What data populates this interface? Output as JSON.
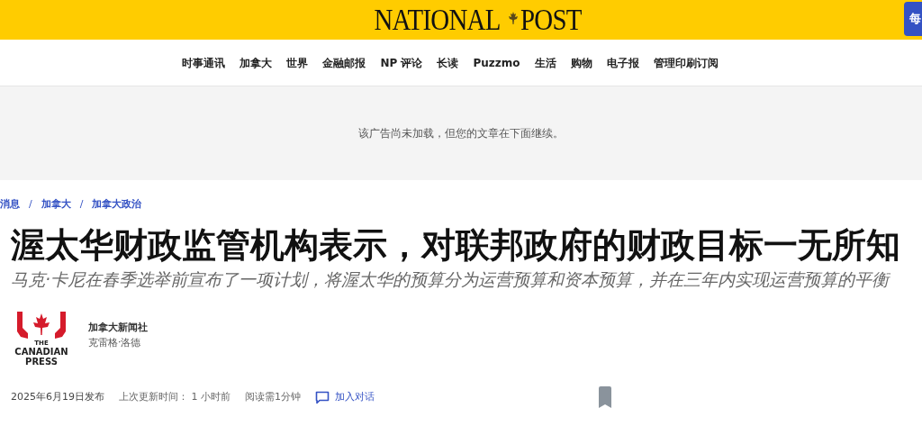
{
  "masthead": {
    "logo_left": "NATIONAL",
    "logo_right": "POST",
    "button": "每"
  },
  "nav": [
    "时事通讯",
    "加拿大",
    "世界",
    "金融邮报",
    "NP 评论",
    "长读",
    "Puzzmo",
    "生活",
    "购物",
    "电子报",
    "管理印刷订阅"
  ],
  "ad_notice": "该广告尚未加载，但您的文章在下面继续。",
  "breadcrumb": [
    "消息",
    "加拿大",
    "加拿大政治"
  ],
  "breadcrumb_separator": "/",
  "headline": "渥太华财政监管机构表示，对联邦政府的财政目标一无所知",
  "subheadline": "马克·卡尼在春季选举前宣布了一项计划，将渥太华的预算分为运营预算和资本预算，并在三年内实现运营预算的平衡",
  "source_logo": {
    "small": "THE",
    "line1": "CANADIAN",
    "line2": "PRESS"
  },
  "byline": {
    "agency": "加拿大新闻社",
    "author": "克雷格·洛德"
  },
  "meta": {
    "published": "2025年6月19日发布",
    "updated": "上次更新时间： 1 小时前",
    "read_time": "阅读需1分钟",
    "comments": "加入对话"
  }
}
